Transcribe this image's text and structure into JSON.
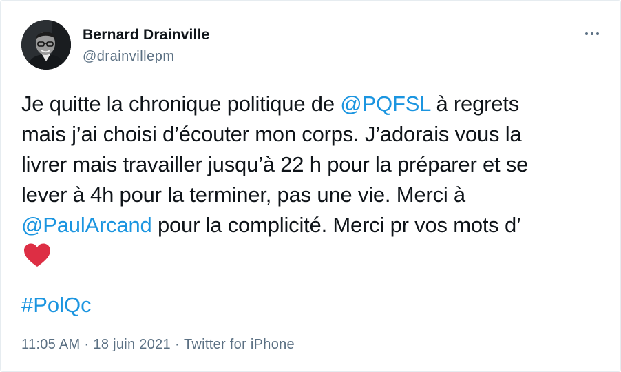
{
  "tweet": {
    "author": {
      "name": "Bernard Drainville",
      "handle": "@drainvillepm"
    },
    "text_lines": [
      {
        "before": "Je quitte la chronique politique de ",
        "mention": "@PQFSL",
        "after": " à regrets"
      },
      "mais j’ai choisi d’écouter mon corps. J’adorais vous la",
      "livrer mais travailler jusqu’à 22 h pour la préparer et se",
      "lever à 4h pour la terminer, pas une vie. Merci à",
      {
        "mention": "@PaulArcand",
        "after": " pour la complicité. Merci pr vos mots d’"
      }
    ],
    "emoji": "red-heart-icon",
    "hashtag": "#PolQc",
    "meta": {
      "time": "11:05 AM",
      "date": "18 juin 2021",
      "separator": "·",
      "source": "Twitter for iPhone"
    }
  },
  "colors": {
    "link": "#1b95e0",
    "text": "#0f1419",
    "secondary": "#5b7083",
    "heart": "#dd2e44"
  }
}
